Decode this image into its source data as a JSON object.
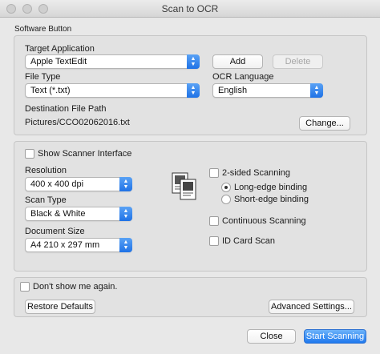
{
  "window": {
    "title": "Scan to OCR"
  },
  "software_button": {
    "group_label": "Software Button",
    "target_application_label": "Target Application",
    "target_application_value": "Apple TextEdit",
    "add_label": "Add",
    "delete_label": "Delete",
    "file_type_label": "File Type",
    "file_type_value": "Text (*.txt)",
    "ocr_language_label": "OCR Language",
    "ocr_language_value": "English",
    "destination_label": "Destination File Path",
    "destination_value": "Pictures/CCO02062016.txt",
    "change_label": "Change..."
  },
  "scan_settings": {
    "show_scanner_interface": "Show Scanner Interface",
    "resolution_label": "Resolution",
    "resolution_value": "400 x 400 dpi",
    "scan_type_label": "Scan Type",
    "scan_type_value": "Black & White",
    "document_size_label": "Document Size",
    "document_size_value": "A4 210 x 297 mm",
    "two_sided_label": "2-sided Scanning",
    "long_edge_label": "Long-edge binding",
    "short_edge_label": "Short-edge binding",
    "continuous_label": "Continuous Scanning",
    "id_card_label": "ID Card Scan",
    "scanner_icon": "duplex-pages-icon"
  },
  "footer": {
    "dont_show_label": "Don't show me again.",
    "restore_defaults_label": "Restore Defaults",
    "advanced_settings_label": "Advanced Settings...",
    "close_label": "Close",
    "start_scanning_label": "Start Scanning"
  },
  "colors": {
    "accent": "#1f79ee",
    "window_bg": "#e8e8e8"
  }
}
